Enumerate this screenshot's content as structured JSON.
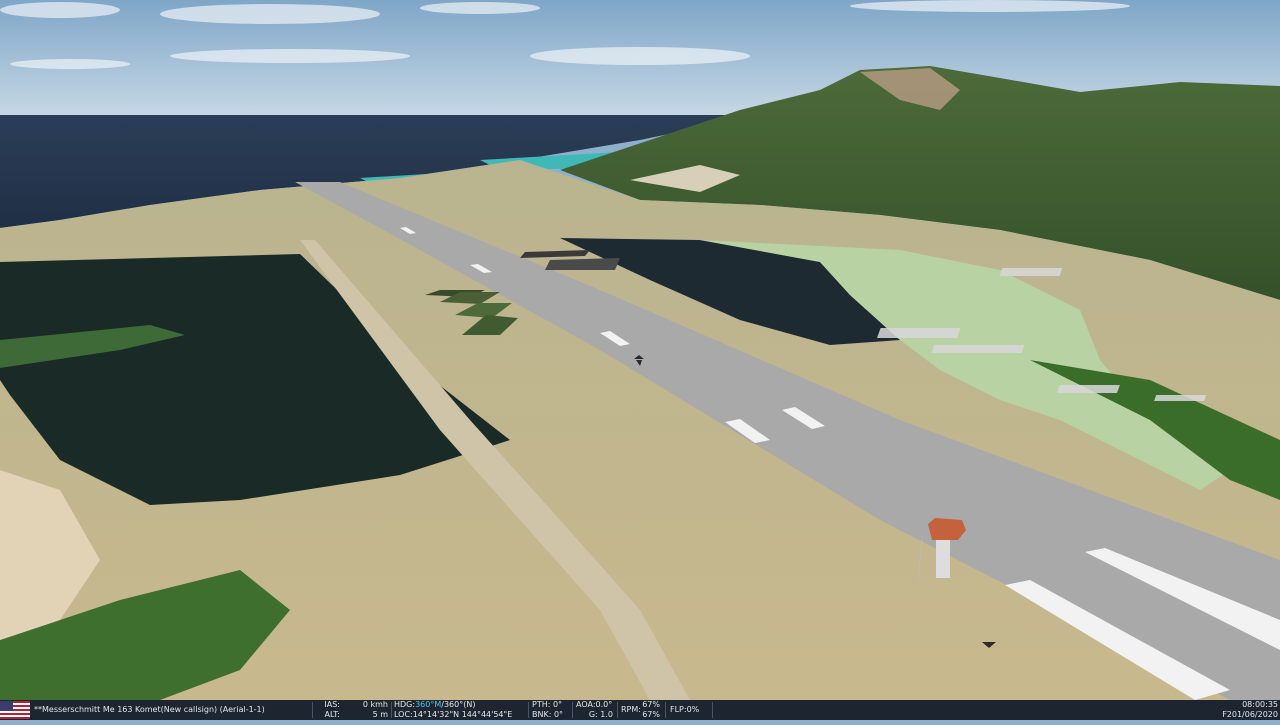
{
  "hud": {
    "country": "flag-usa-icon",
    "unit_name": "**Messerschmitt Me 163 Komet(New callsign) (Aerial-1-1)",
    "ias_label": "IAS:",
    "ias_value": "0 kmh",
    "alt_label": "ALT:",
    "alt_value": "5 m",
    "hdg_label": "HDG:",
    "hdg_value": "360°M",
    "hdg_true": "/360°(N)",
    "loc_label": "LOC:",
    "loc_value": "14°14'32\"N 144°44'54\"E",
    "pth_label": "PTH:",
    "pth_value": "0°",
    "bnk_label": "BNK:",
    "bnk_value": "0°",
    "aoa_label": "AOA:",
    "aoa_value": "0.0°",
    "g_label": "G:",
    "g_value": "1.0",
    "rpm_label": "RPM:",
    "rpm_value_1": "67%",
    "rpm_value_2": "67%",
    "flp_label": "FLP:",
    "flp_value": "0%",
    "time": "08:00:35",
    "date": "F201/06/2020"
  },
  "colors": {
    "hud_background": "#1d2530",
    "hud_highlight": "#4fc3f7",
    "sky": "#9dbbd6",
    "sea": "#26364d",
    "runway": "#a9a9a9"
  }
}
